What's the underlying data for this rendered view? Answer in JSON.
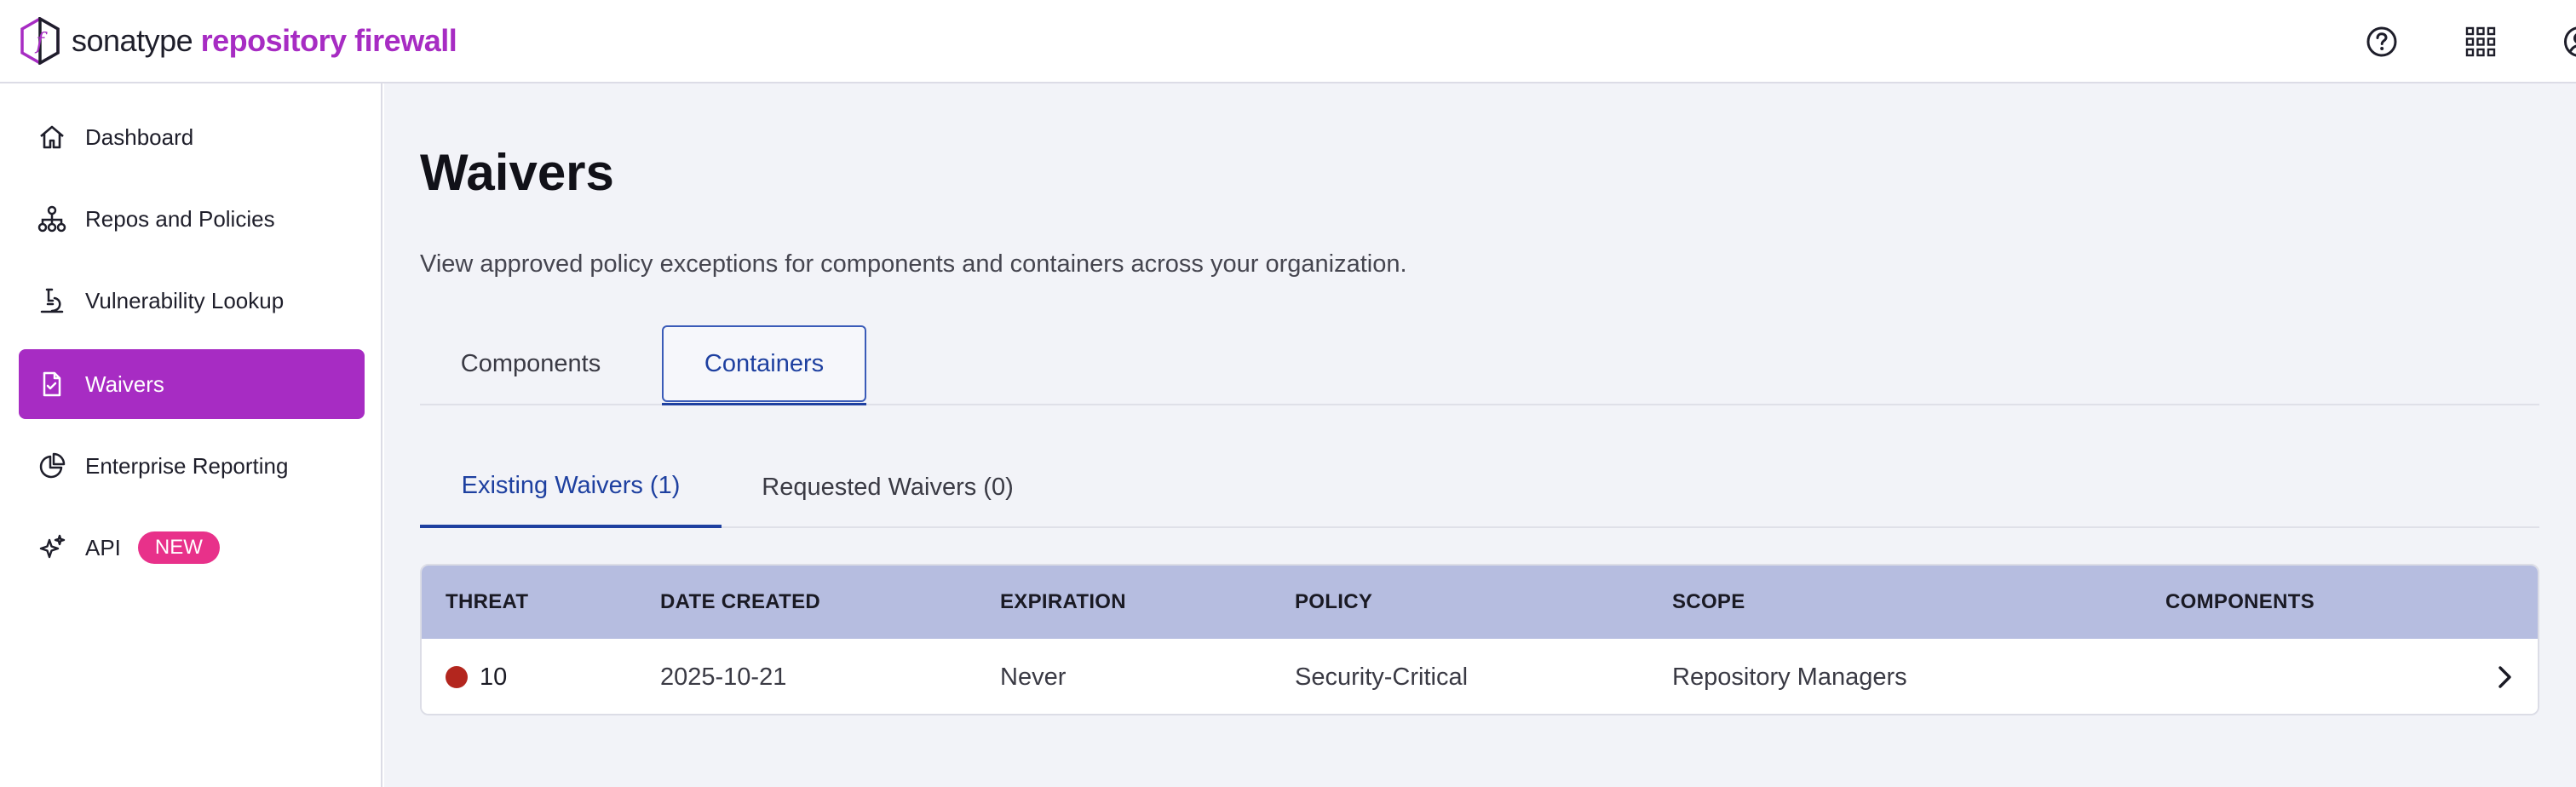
{
  "header": {
    "brand_primary": "sonatype",
    "brand_secondary": "repository firewall",
    "icons": [
      "help-icon",
      "apps-grid-icon",
      "user-account-icon"
    ]
  },
  "sidebar": {
    "items": [
      {
        "label": "Dashboard",
        "icon": "home-icon"
      },
      {
        "label": "Repos and Policies",
        "icon": "hierarchy-icon"
      },
      {
        "label": "Vulnerability Lookup",
        "icon": "microscope-icon"
      },
      {
        "label": "Waivers",
        "icon": "document-check-icon",
        "active": true
      },
      {
        "label": "Enterprise Reporting",
        "icon": "pie-chart-icon"
      },
      {
        "label": "API",
        "icon": "sparkle-icon",
        "badge": "NEW"
      }
    ]
  },
  "main": {
    "title": "Waivers",
    "description": "View approved policy exceptions for components and containers across your organization.",
    "primary_tabs": [
      {
        "label": "Components",
        "active": false
      },
      {
        "label": "Containers",
        "active": true
      }
    ],
    "secondary_tabs": [
      {
        "label": "Existing Waivers (1)",
        "active": true
      },
      {
        "label": "Requested Waivers (0)",
        "active": false
      }
    ],
    "table": {
      "columns": [
        "THREAT",
        "DATE CREATED",
        "EXPIRATION",
        "POLICY",
        "SCOPE",
        "COMPONENTS"
      ],
      "rows": [
        {
          "threat": "10",
          "date_created": "2025-10-21",
          "expiration": "Never",
          "policy": "Security-Critical",
          "scope": "Repository Managers",
          "components": ""
        }
      ]
    }
  },
  "colors": {
    "brand_purple": "#a72cc3",
    "accent_blue": "#1e40a0",
    "table_header": "#b6bde0",
    "threat_critical": "#b3261e",
    "badge_pink": "#e8318a",
    "main_background": "#f2f3f8"
  }
}
